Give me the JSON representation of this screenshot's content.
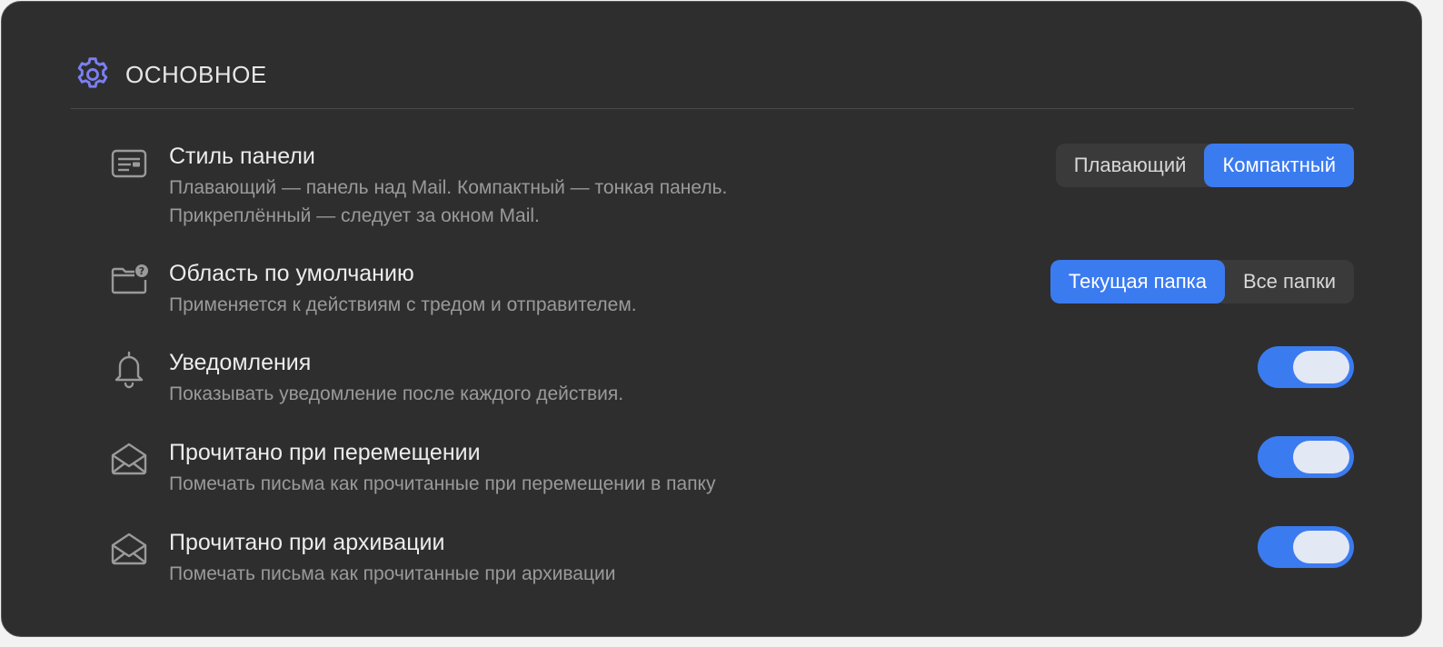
{
  "section": {
    "title": "ОСНОВНОЕ",
    "icon": "gear-icon",
    "accent": "#7b7ff0"
  },
  "rows": [
    {
      "icon": "panel-icon",
      "title": "Стиль панели",
      "desc_line1": "Плавающий — панель над Mail. Компактный — тонкая панель.",
      "desc_line2": "Прикреплённый — следует за окном Mail.",
      "control": "segmented",
      "options": [
        "Плавающий",
        "Компактный"
      ],
      "selected": "Компактный"
    },
    {
      "icon": "folder-question-icon",
      "title": "Область по умолчанию",
      "desc_line1": "Применяется к действиям с тредом и отправителем.",
      "control": "segmented",
      "options": [
        "Текущая папка",
        "Все папки"
      ],
      "selected": "Текущая папка"
    },
    {
      "icon": "bell-icon",
      "title": "Уведомления",
      "desc_line1": "Показывать уведомление после каждого действия.",
      "control": "toggle",
      "on": true
    },
    {
      "icon": "envelope-open-icon",
      "title": "Прочитано при перемещении",
      "desc_line1": "Помечать письма как прочитанные при перемещении в папку",
      "control": "toggle",
      "on": true
    },
    {
      "icon": "envelope-open-icon",
      "title": "Прочитано при архивации",
      "desc_line1": "Помечать письма как прочитанные при архивации",
      "control": "toggle",
      "on": true
    }
  ],
  "colors": {
    "background": "#2e2e2e",
    "accent_blue": "#3b7bf0",
    "title_text": "#ececec",
    "desc_text": "#9a9a9a"
  }
}
